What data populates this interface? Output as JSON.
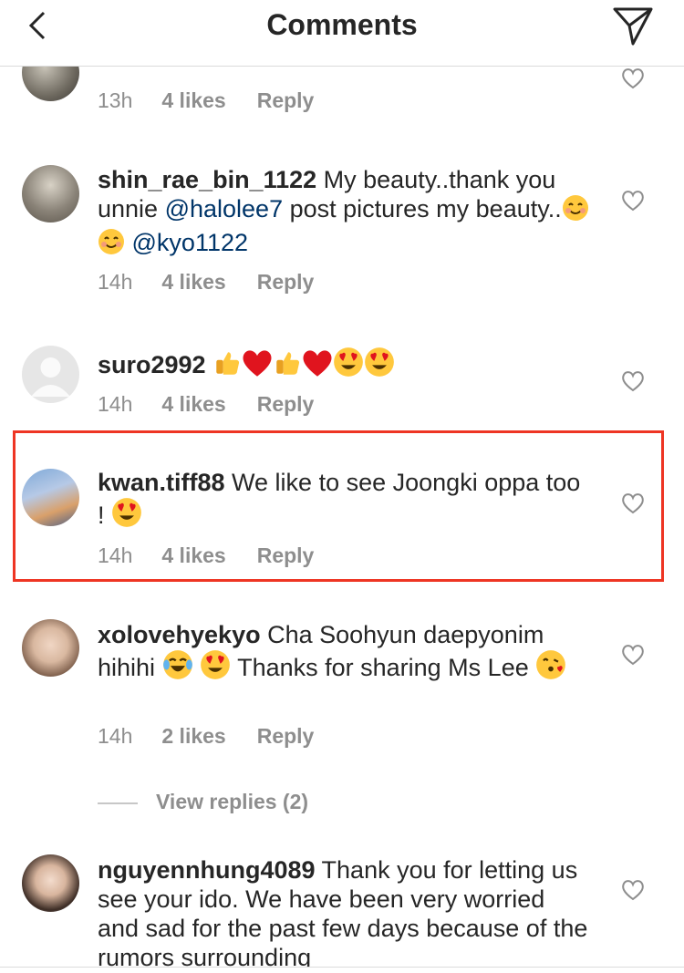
{
  "header": {
    "title": "Comments",
    "back_icon": "chevron-left-icon",
    "send_icon": "paper-plane-icon"
  },
  "comments": [
    {
      "time": "13h",
      "likes": "4 likes",
      "reply": "Reply"
    },
    {
      "username": "shin_rae_bin_1122",
      "text1": " My beauty..thank you unnie ",
      "mention1": "@halolee7",
      "text2": " post pictures my beauty..",
      "mention2": "@kyo1122",
      "time": "14h",
      "likes": "4 likes",
      "reply": "Reply"
    },
    {
      "username": "suro2992",
      "time": "14h",
      "likes": "4 likes",
      "reply": "Reply"
    },
    {
      "username": "kwan.tiff88",
      "text1": " We like to see Joongki oppa too ! ",
      "time": "14h",
      "likes": "4 likes",
      "reply": "Reply"
    },
    {
      "username": "xolovehyekyo",
      "text1": " Cha Soohyun daepyonim hihihi ",
      "text2": " Thanks for sharing Ms Lee",
      "time": "14h",
      "likes": "2 likes",
      "reply": "Reply"
    },
    {
      "username": "nguyennhung4089",
      "text1": " Thank you for letting us see your ido. We have been very worried and sad for the past few days because of the rumors surrounding"
    }
  ],
  "view_replies": "View replies (2)",
  "colors": {
    "highlight": "#ee3523",
    "mention": "#003569",
    "meta": "#8e8e8e"
  }
}
